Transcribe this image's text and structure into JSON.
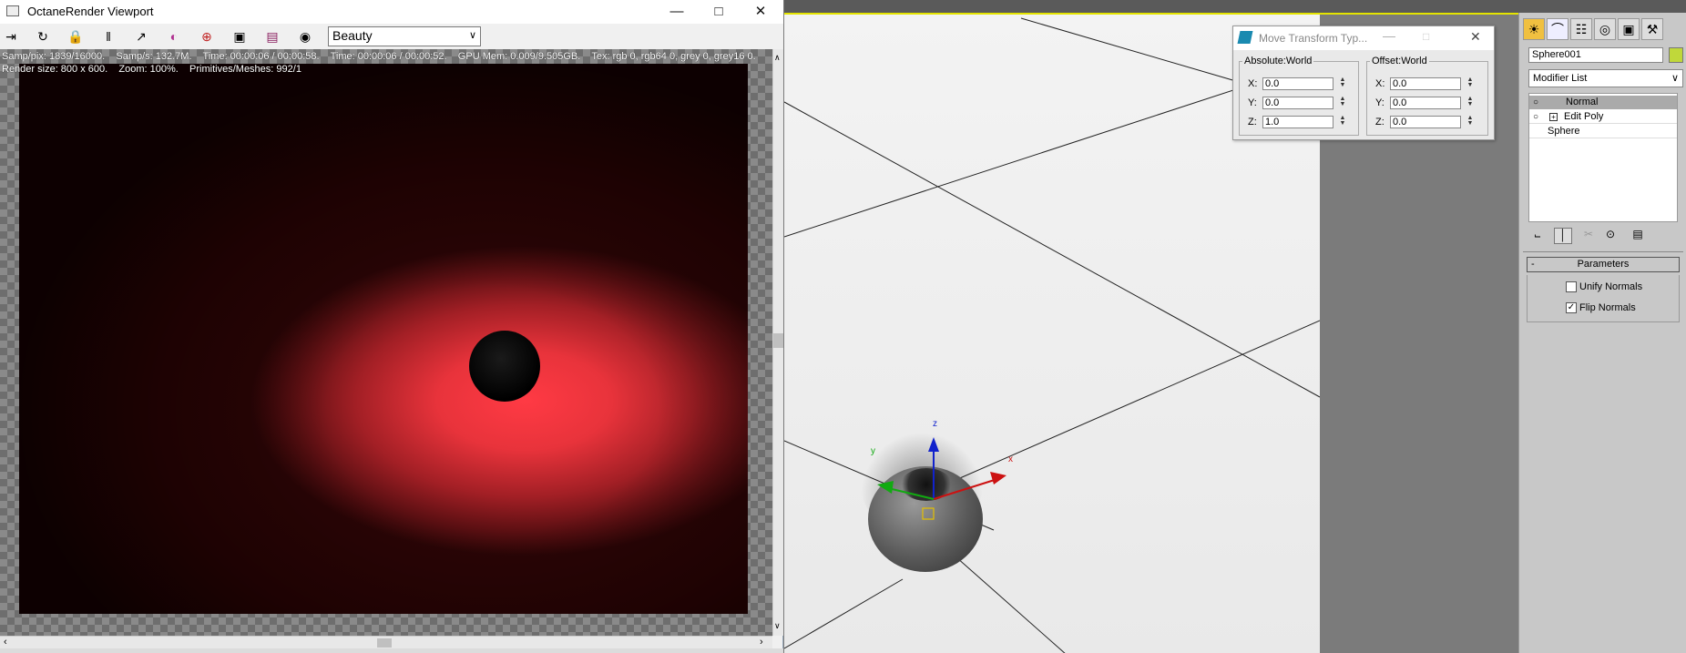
{
  "octane": {
    "title": "OctaneRender Viewport",
    "toolbar": {
      "icons": [
        "export-icon",
        "refresh-icon",
        "lock-icon",
        "pause-icon",
        "histogram-icon",
        "color-wheel-icon",
        "target-icon",
        "region-icon",
        "film-icon",
        "camera-icon"
      ],
      "pass_select": "Beauty"
    },
    "status": {
      "line1": "Samp/pix: 1839/16000.    Samp/s: 132.7M.    Time: 00:00:06 / 00:00:58.    Time: 00:00:06 / 00:00:52.    GPU Mem: 0.009/9.505GB.    Tex: rgb 0, rgb64 0, grey 0, grey16 0.",
      "line2": "Render size: 800 x 600.    Zoom: 100%.    Primitives/Meshes: 992/1"
    }
  },
  "move_transform": {
    "title": "Move Transform Typ...",
    "absolute": {
      "label": "Absolute:World",
      "x_label": "X:",
      "x": "0.0",
      "y_label": "Y:",
      "y": "0.0",
      "z_label": "Z:",
      "z": "1.0"
    },
    "offset": {
      "label": "Offset:World",
      "x_label": "X:",
      "x": "0.0",
      "y_label": "Y:",
      "y": "0.0",
      "z_label": "Z:",
      "z": "0.0"
    }
  },
  "viewport": {
    "gizmo": {
      "x": "x",
      "y": "y",
      "z": "z"
    }
  },
  "command_panel": {
    "object_name": "Sphere001",
    "object_color": "#c0d83a",
    "modifier_list": "Modifier List",
    "stack": [
      {
        "label": "Normal",
        "selected": true
      },
      {
        "label": "Edit Poly",
        "selected": false
      },
      {
        "label": "Sphere",
        "selected": false
      }
    ],
    "parameters": {
      "header": "Parameters",
      "collapse": "-",
      "unify_normals": {
        "label": "Unify Normals",
        "checked": false
      },
      "flip_normals": {
        "label": "Flip Normals",
        "checked": true
      }
    }
  },
  "colors": {
    "render_glow": "#ff3a44",
    "viewport_border": "#e4e400",
    "gizmo_x": "#cc1111",
    "gizmo_y": "#11aa11",
    "gizmo_z": "#1122cc"
  }
}
